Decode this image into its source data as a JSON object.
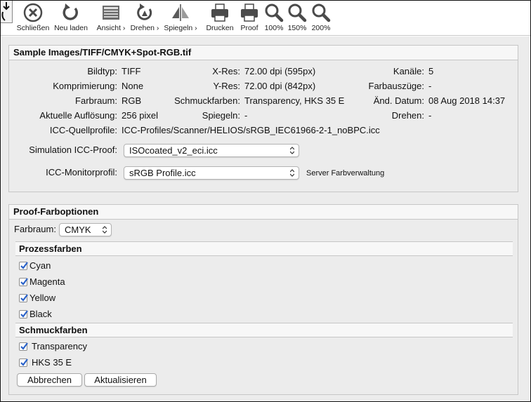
{
  "toolbar": {
    "download_icon": "download-arrow-icon",
    "buttons": [
      {
        "label": "Schließen",
        "icon": "close-circle-icon"
      },
      {
        "label": "Neu laden",
        "icon": "reload-icon"
      },
      {
        "label": "Ansicht ›",
        "icon": "view-icon"
      },
      {
        "label": "Drehen ›",
        "icon": "rotate-icon"
      },
      {
        "label": "Spiegeln ›",
        "icon": "mirror-icon"
      },
      {
        "label": "Drucken",
        "icon": "printer-icon"
      },
      {
        "label": "Proof",
        "icon": "proof-printer-icon"
      },
      {
        "label": "100%",
        "icon": "zoom-icon"
      },
      {
        "label": "150%",
        "icon": "zoom-icon"
      },
      {
        "label": "200%",
        "icon": "zoom-icon"
      }
    ]
  },
  "file": {
    "title": "Sample Images/TIFF/CMYK+Spot-RGB.tif",
    "info": {
      "bildtyp": {
        "label": "Bildtyp:",
        "value": "TIFF"
      },
      "komprimierung": {
        "label": "Komprimierung:",
        "value": "None"
      },
      "farbraum": {
        "label": "Farbraum:",
        "value": "RGB"
      },
      "aufloesung": {
        "label": "Aktuelle Auflösung:",
        "value": "256 pixel"
      },
      "quellprofil": {
        "label": "ICC-Quellprofile:",
        "value": "ICC-Profiles/Scanner/HELIOS/sRGB_IEC61966-2-1_noBPC.icc"
      },
      "xres": {
        "label": "X-Res:",
        "value": "72.00 dpi (595px)"
      },
      "yres": {
        "label": "Y-Res:",
        "value": "72.00 dpi (842px)"
      },
      "schmuckfarben": {
        "label": "Schmuckfarben:",
        "value": "Transparency, HKS 35 E"
      },
      "spiegeln": {
        "label": "Spiegeln:",
        "value": "-"
      },
      "kanaele": {
        "label": "Kanäle:",
        "value": "5"
      },
      "farbauszuege": {
        "label": "Farbauszüge:",
        "value": "-"
      },
      "datum": {
        "label": "Änd. Datum:",
        "value": "08 Aug 2018 14:37"
      },
      "drehen": {
        "label": "Drehen:",
        "value": "-"
      }
    },
    "simulation_label": "Simulation ICC-Proof:",
    "simulation_value": "ISOcoated_v2_eci.icc",
    "monitor_label": "ICC-Monitorprofil:",
    "monitor_value": "sRGB Profile.icc",
    "server_note": "Server Farbverwaltung"
  },
  "proof": {
    "title": "Proof-Farboptionen",
    "farbraum_label": "Farbraum:",
    "farbraum_value": "CMYK",
    "prozess_title": "Prozessfarben",
    "prozess": [
      "Cyan",
      "Magenta",
      "Yellow",
      "Black"
    ],
    "schmuck_title": "Schmuckfarben",
    "schmuck": [
      "Transparency",
      "HKS 35 E"
    ],
    "cancel_label": "Abbrechen",
    "update_label": "Aktualisieren"
  },
  "colors": {
    "icon_gray": "#5a5a5a",
    "check_blue": "#2a62c9"
  }
}
